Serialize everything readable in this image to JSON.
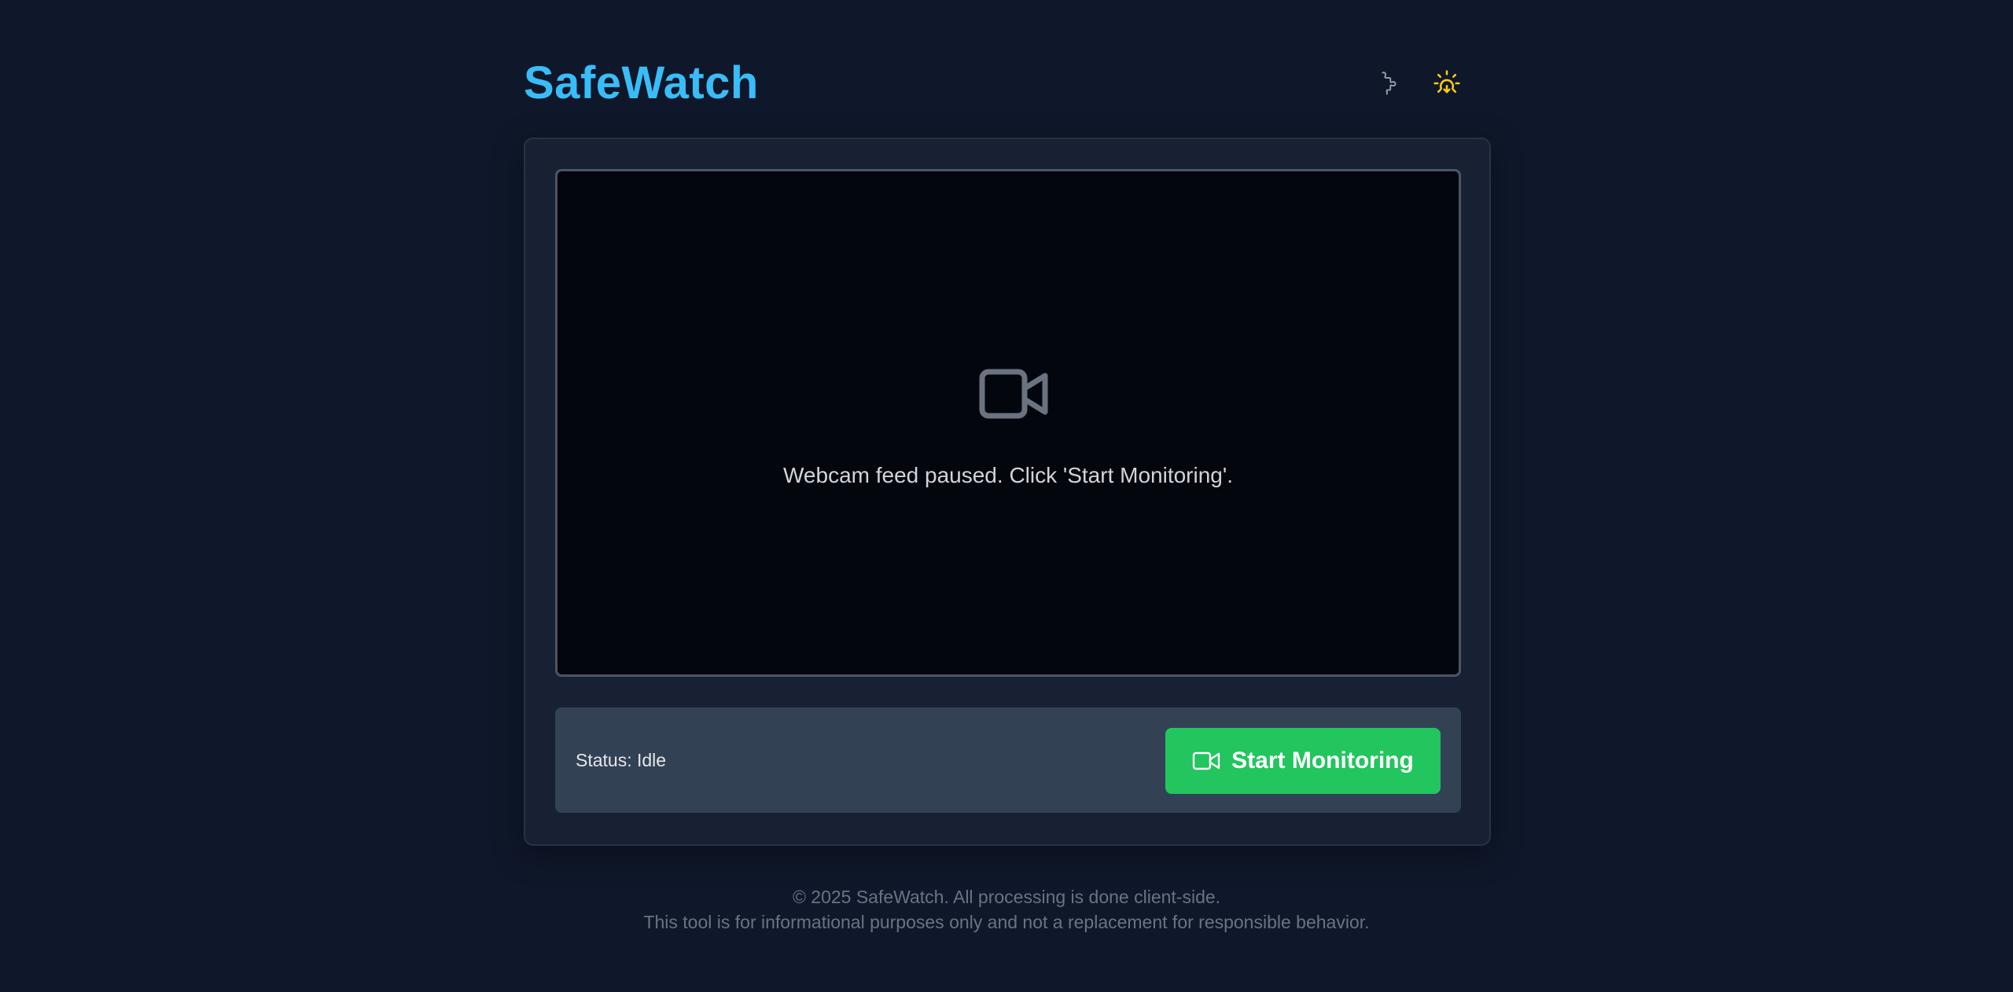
{
  "app": {
    "title": "SafeWatch"
  },
  "header": {
    "extensions_icon": "puzzle-icon",
    "theme_icon": "sun-icon"
  },
  "video": {
    "placeholder_icon": "video-camera-icon",
    "placeholder_text": "Webcam feed paused. Click 'Start Monitoring'."
  },
  "controls": {
    "status_label": "Status: Idle",
    "start_button_label": "Start Monitoring",
    "start_button_icon": "video-camera-icon"
  },
  "footer": {
    "line1": "© 2025 SafeWatch. All processing is done client-side.",
    "line2": "This tool is for informational purposes only and not a replacement for responsible behavior."
  },
  "colors": {
    "background": "#0f172a",
    "card": "#182133",
    "accent": "#38bdf8",
    "button": "#22c55e",
    "sun": "#facc15"
  }
}
